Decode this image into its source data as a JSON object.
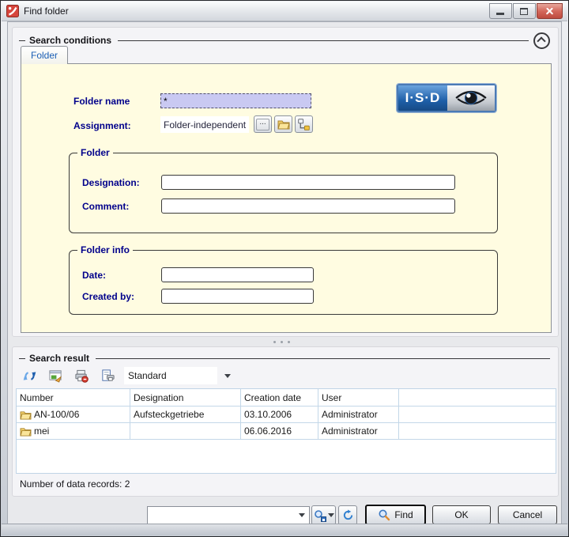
{
  "window": {
    "title": "Find folder"
  },
  "search_conditions": {
    "legend": "Search conditions",
    "tab_label": "Folder",
    "folder_name_label": "Folder name",
    "folder_name_value": "*",
    "assignment_label": "Assignment:",
    "assignment_value": "Folder-independent",
    "browse_button_label": "...",
    "logo_text": "I·S·D",
    "folder_group": {
      "legend": "Folder",
      "designation_label": "Designation:",
      "designation_value": "",
      "comment_label": "Comment:",
      "comment_value": ""
    },
    "folder_info_group": {
      "legend": "Folder info",
      "date_label": "Date:",
      "date_value": "",
      "created_by_label": "Created by:",
      "created_by_value": ""
    }
  },
  "search_result": {
    "legend": "Search result",
    "toolbar": {
      "view_preset_value": "Standard",
      "icons": [
        "refresh-icon",
        "export-image-icon",
        "print-settings-icon",
        "print-list-icon"
      ]
    },
    "table": {
      "columns": [
        "Number",
        "Designation",
        "Creation date",
        "User",
        ""
      ],
      "rows": [
        {
          "number": "AN-100/06",
          "designation": "Aufsteckgetriebe",
          "creation_date": "03.10.2006",
          "user": "Administrator"
        },
        {
          "number": "mei",
          "designation": "",
          "creation_date": "06.06.2016",
          "user": "Administrator"
        }
      ]
    },
    "status_label": "Number of data records:",
    "status_count": "2"
  },
  "footer": {
    "saved_search_value": "",
    "find_label": "Find",
    "ok_label": "OK",
    "cancel_label": "Cancel"
  }
}
